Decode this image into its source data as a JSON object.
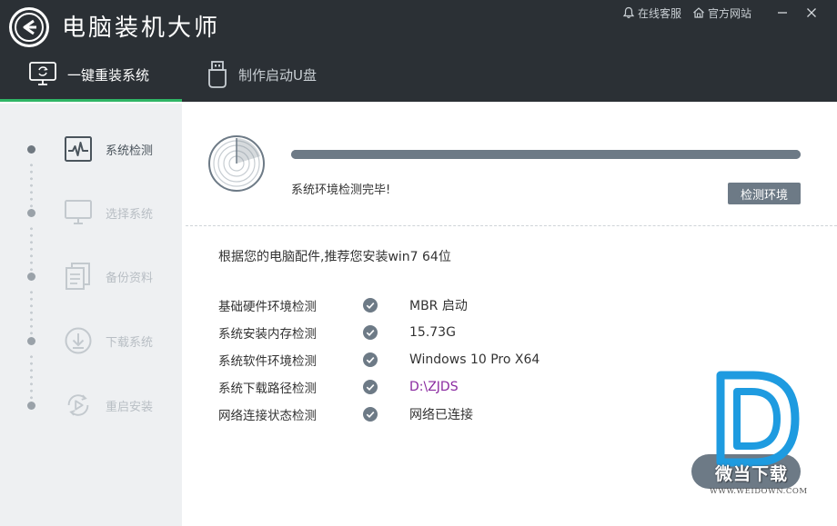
{
  "app": {
    "title": "电脑装机大师"
  },
  "top_links": {
    "support": "在线客服",
    "website": "官方网站"
  },
  "tabs": [
    {
      "label": "一键重装系统",
      "active": true
    },
    {
      "label": "制作启动U盘",
      "active": false
    }
  ],
  "steps": [
    {
      "label": "系统检测",
      "icon": "pulse-monitor-icon",
      "active": true
    },
    {
      "label": "选择系统",
      "icon": "monitor-icon",
      "active": false
    },
    {
      "label": "备份资料",
      "icon": "documents-icon",
      "active": false
    },
    {
      "label": "下载系统",
      "icon": "download-icon",
      "active": false
    },
    {
      "label": "重启安装",
      "icon": "restart-play-icon",
      "active": false
    }
  ],
  "detection": {
    "progress": 1.0,
    "status_text": "系统环境检测完毕!",
    "detect_button": "检测环境"
  },
  "recommendation": "根据您的电脑配件,推荐您安装win7 64位",
  "checks": [
    {
      "label": "基础硬件环境检测",
      "value": "MBR 启动"
    },
    {
      "label": "系统安装内存检测",
      "value": "15.73G"
    },
    {
      "label": "系统软件环境检测",
      "value": "Windows 10 Pro X64"
    },
    {
      "label": "系统下载路径检测",
      "value": "D:\\ZJDS",
      "is_link": true
    },
    {
      "label": "网络连接状态检测",
      "value": "网络已连接"
    }
  ],
  "watermark": {
    "name": "微当下载",
    "url": "WWW.WEIDOWN.COM"
  },
  "colors": {
    "titlebar": "#2b3035",
    "accent_green": "#2fb565",
    "button_gray": "#6d7a86",
    "sidebar_bg": "#eef0f2",
    "link_purple": "#8a2aa0",
    "watermark_blue": "#1e9be0"
  }
}
